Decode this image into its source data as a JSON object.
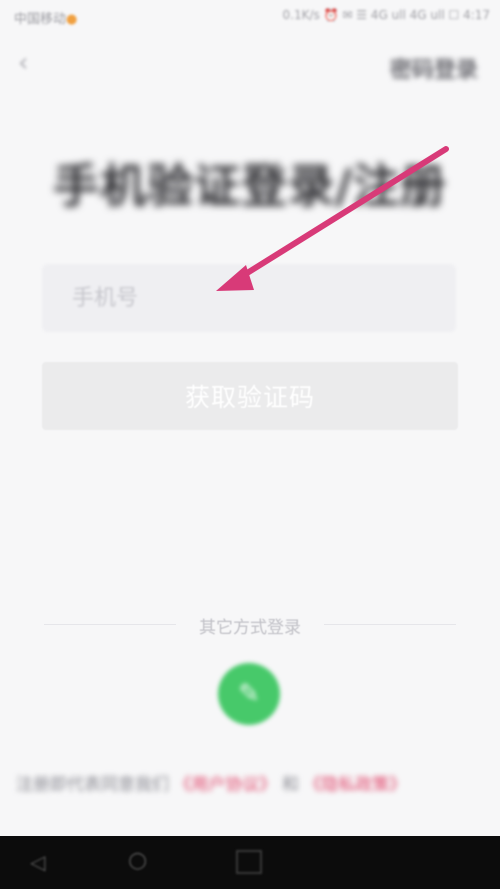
{
  "status_bar": {
    "carrier": "中国移动",
    "carrier_dot": "●",
    "right_info": "0.1K/s ⏰ ✉ ☰ 4G ull 4G ull ☐ 4:17"
  },
  "top_bar": {
    "back_icon": "‹",
    "password_login_label": "密码登录"
  },
  "title": "手机验证登录/注册",
  "phone_input": {
    "placeholder": "手机号",
    "value": ""
  },
  "get_code_button": {
    "label": "获取验证码"
  },
  "other_methods": {
    "label": "其它方式登录",
    "wechat_icon": "wechat-icon"
  },
  "agreement": {
    "prefix": "注册即代表同意我们",
    "user_agreement": "《用户协议》",
    "and": "和",
    "privacy_policy": "《隐私政策》"
  },
  "annotation": {
    "arrow_color": "#d83a78"
  },
  "colors": {
    "background": "#f7f7f8",
    "input_bg": "#efeff2",
    "button_disabled": "#ebebec",
    "wechat_green": "#47c96a",
    "link_pink": "#e0456a"
  }
}
